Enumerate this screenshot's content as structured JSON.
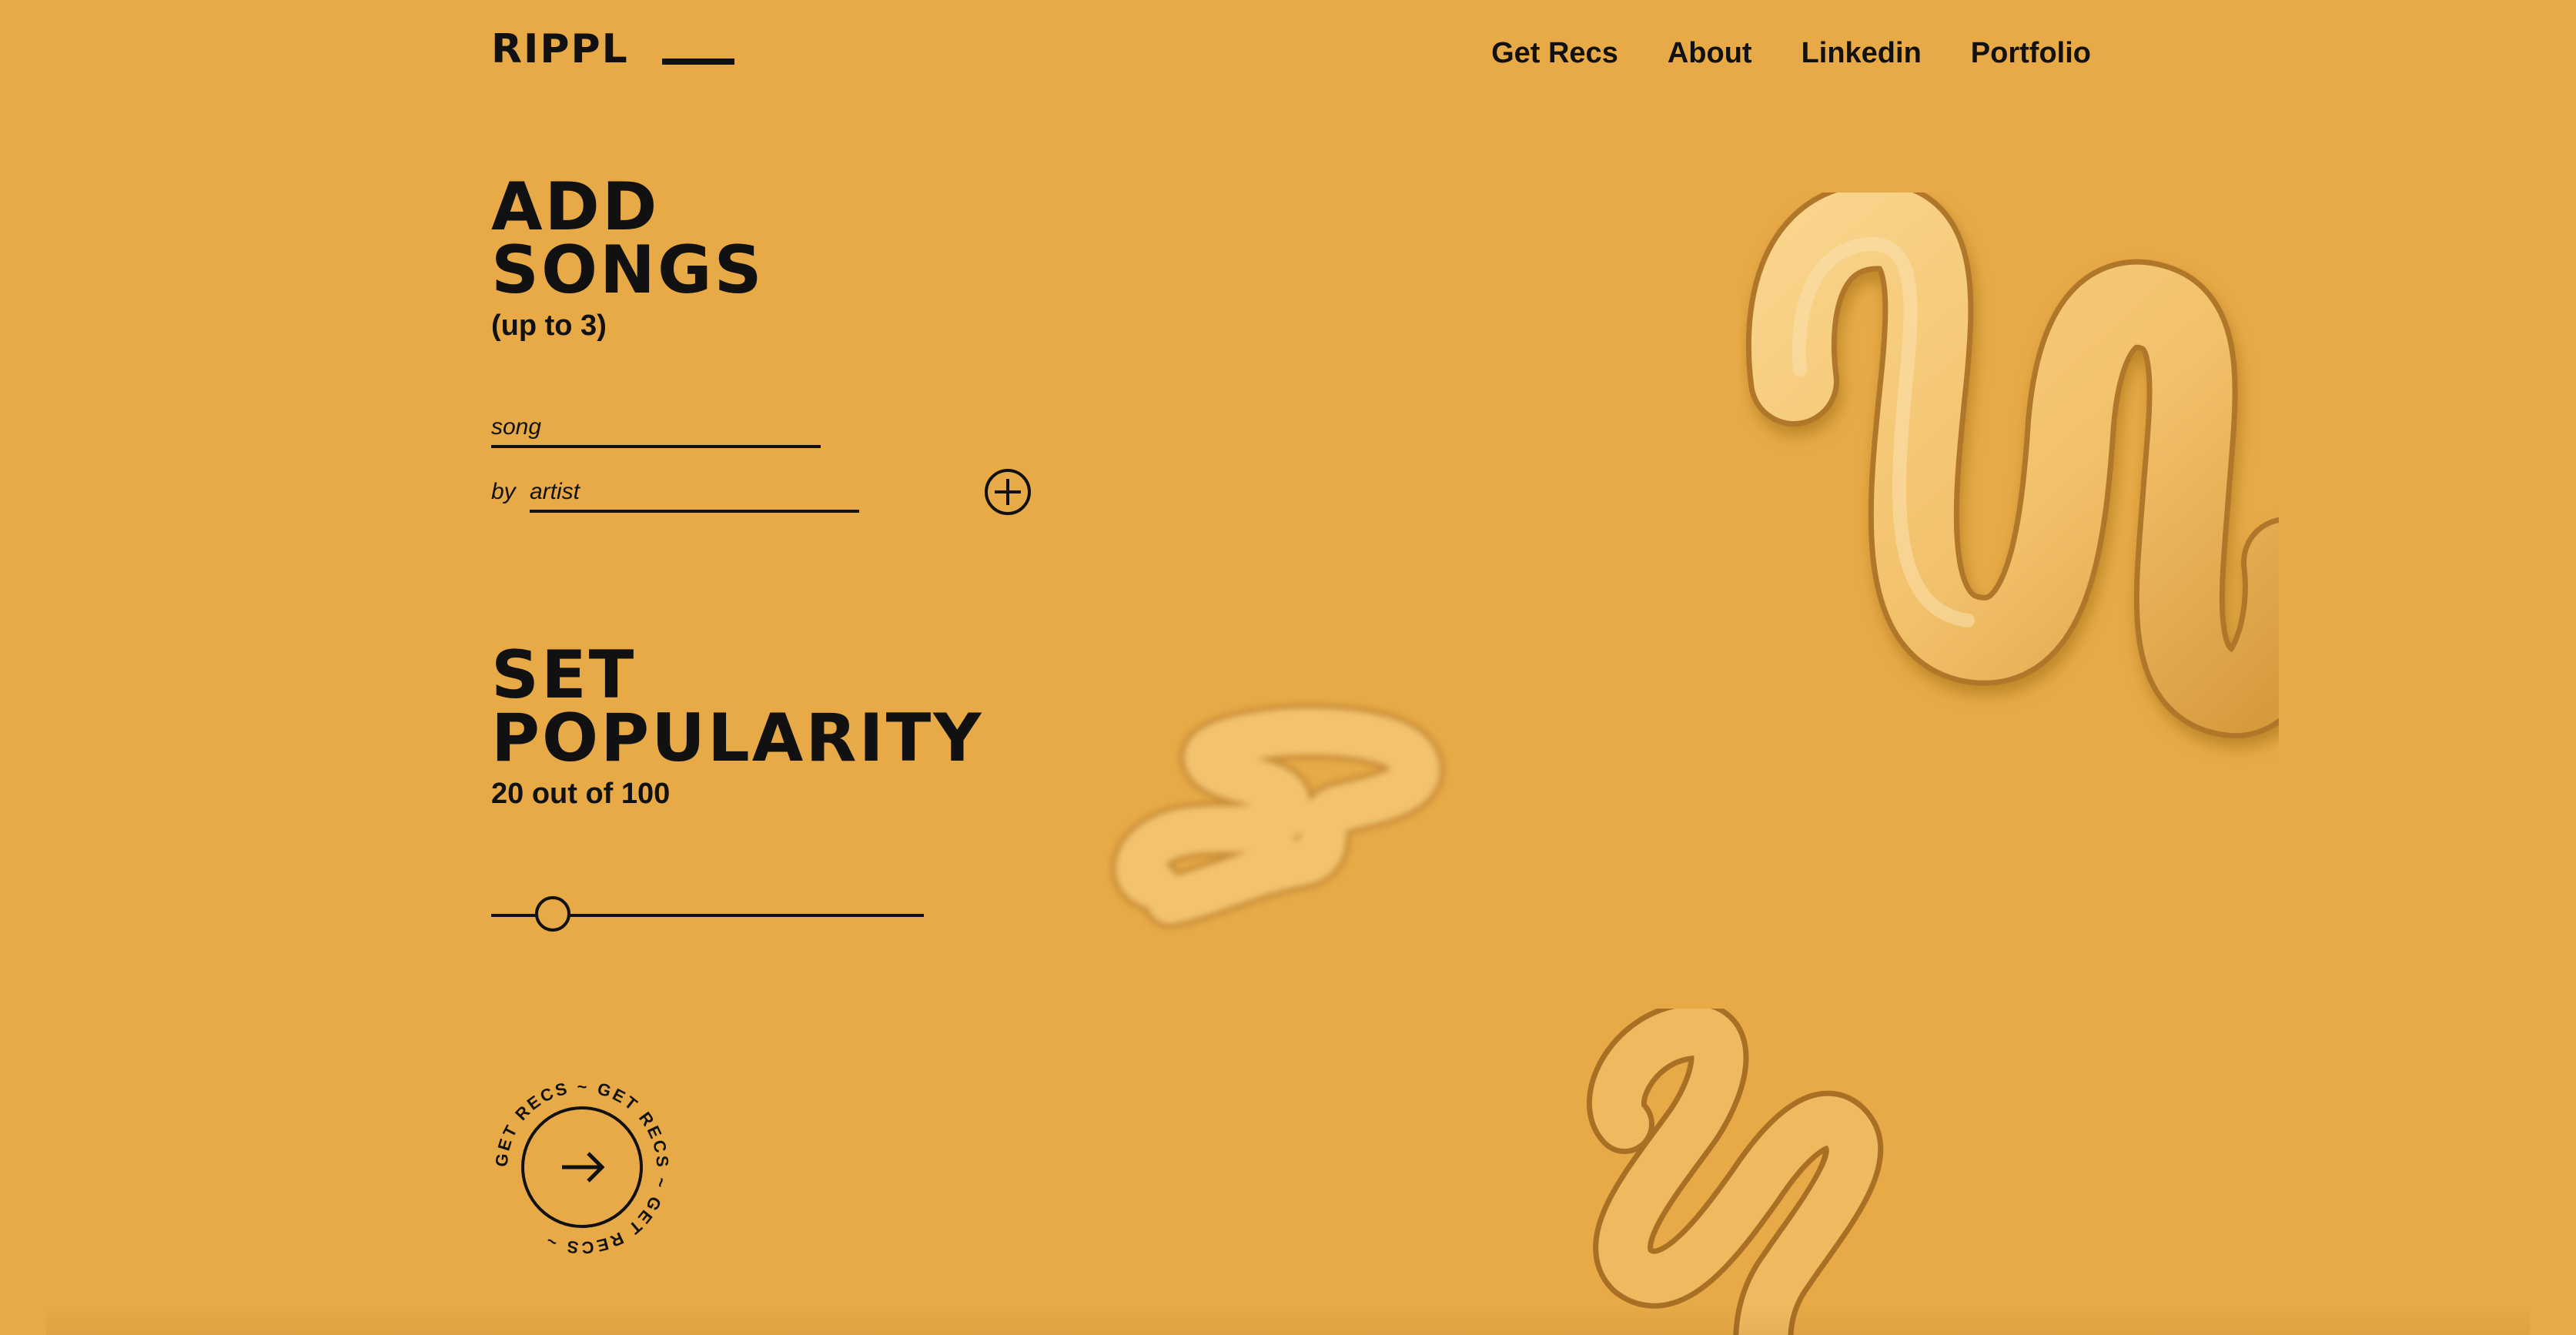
{
  "brand": {
    "logo_text": "RIPPL"
  },
  "nav": {
    "items": [
      {
        "label": "Get Recs"
      },
      {
        "label": "About"
      },
      {
        "label": "Linkedin"
      },
      {
        "label": "Portfolio"
      }
    ]
  },
  "add_songs": {
    "title_line1": "ADD",
    "title_line2": "SONGS",
    "subtitle": "(up to 3)",
    "song_placeholder": "song",
    "by_label": "by",
    "artist_placeholder": "artist",
    "add_icon": "plus-circle-icon"
  },
  "popularity": {
    "title_line1": "SET",
    "title_line2": "POPULARITY",
    "value_text": "20 out of 100",
    "value": 20,
    "max": 100
  },
  "cta": {
    "ring_text": "GET RECS ~ GET RECS ~ GET RECS ~ ",
    "icon": "arrow-right-icon"
  },
  "colors": {
    "background": "#E8AA47",
    "ink": "#111111",
    "squiggle_light": "#F6CB7C",
    "squiggle_mid": "#EDB65A",
    "squiggle_dark": "#B97E25"
  }
}
